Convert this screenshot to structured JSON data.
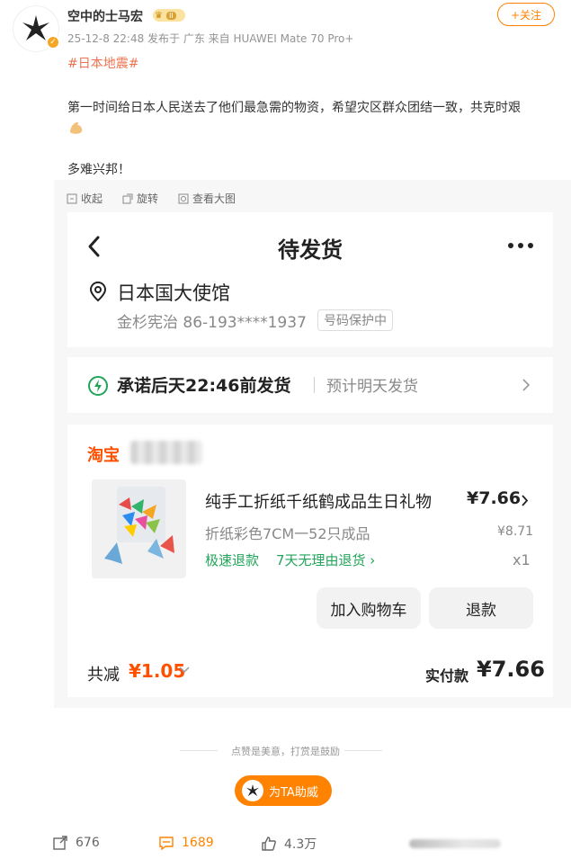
{
  "post": {
    "username": "空中的士马宏",
    "vip_level": "II",
    "meta": "25-12-8 22:48 发布于 广东 来自 HUAWEI Mate 70 Pro+",
    "follow_label": "+关注",
    "hashtag": "#日本地震#",
    "content": "第一时间给日本人民送去了他们最急需的物资，希望灾区群众团结一致，共克时艰",
    "content2": "多难兴邦！"
  },
  "image_tools": {
    "collect": "收起",
    "rotate": "旋转",
    "view_large": "查看大图"
  },
  "order": {
    "title": "待发货",
    "address_name": "日本国大使馆",
    "contact": "金杉宪治 86-193****1937",
    "protect_tag": "号码保护中",
    "ship_promise": "承诺后天22:46前发货",
    "ship_estimate": "预计明天发货",
    "shop_name": "淘宝",
    "product_title": "纯手工折纸千纸鹤成品生日礼物",
    "product_price": "¥7.66",
    "product_sku": "折纸彩色7CM一52只成品",
    "original_price": "¥8.71",
    "tag_refund": "极速退款",
    "tag_return": "7天无理由退货 ›",
    "quantity": "x1",
    "btn_cart": "加入购物车",
    "btn_refund": "退款",
    "discount_label": "共减",
    "discount_amount": "¥1.05",
    "paid_label": "实付款",
    "paid_amount": "¥7.66"
  },
  "reward": {
    "text": "点赞是美意，打赏是鼓励",
    "button": "为TA助威"
  },
  "stats": {
    "reposts": "676",
    "comments": "1689",
    "likes": "4.3万"
  },
  "colors": {
    "accent": "#ff8200",
    "taobao": "#ff5000",
    "green": "#22a55a",
    "hashtag": "#eb7350"
  }
}
